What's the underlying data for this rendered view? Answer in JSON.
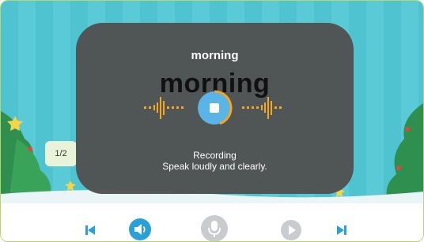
{
  "card": {
    "word_title": "morning",
    "word_display": "morning",
    "counter": "1/2",
    "status_line1": "Recording",
    "status_line2": "Speak loudly and clearly."
  },
  "colors": {
    "accent_orange": "#f5a623",
    "record_blue": "#5ab4e6",
    "overlay_grey": "#505050",
    "background_teal": "#4fc3cf"
  },
  "toolbar": {
    "items": [
      {
        "icon": "skip-back-icon",
        "state": "enabled"
      },
      {
        "icon": "speaker-icon",
        "state": "active"
      },
      {
        "icon": "microphone-icon",
        "state": "disabled"
      },
      {
        "icon": "play-icon",
        "state": "disabled"
      },
      {
        "icon": "skip-forward-icon",
        "state": "enabled"
      }
    ]
  }
}
